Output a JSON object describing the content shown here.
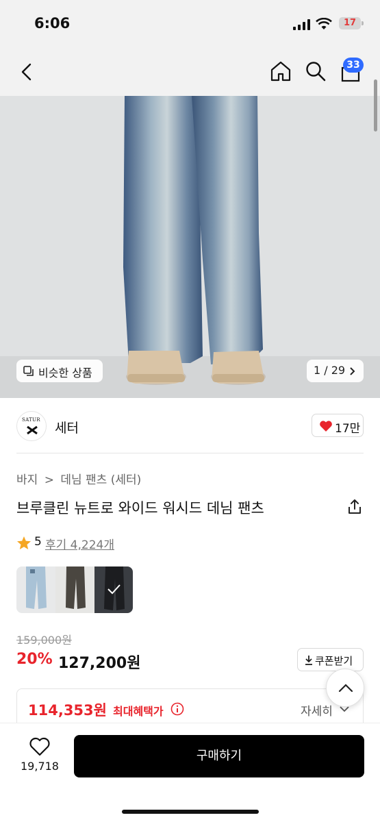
{
  "status_bar": {
    "time": "6:06",
    "battery": "17"
  },
  "nav": {
    "cart_count": "33"
  },
  "gallery": {
    "similar_label": "비슷한 상품",
    "page_indicator": "1 / 29"
  },
  "brand": {
    "logo_text": "SATUR",
    "name": "세터",
    "likes": "17만"
  },
  "breadcrumb": {
    "root": "바지",
    "sep": ">",
    "current": "데님 팬츠 (세터)"
  },
  "product": {
    "title": "브루클린 뉴트로 와이드 워시드 데님 팬츠",
    "rating": "5",
    "reviews_label": "후기 4,224개",
    "original_price": "159,000원",
    "discount": "20%",
    "price": "127,200원",
    "coupon_label": "쿠폰받기",
    "max_benefit_price": "114,353원",
    "max_benefit_label": "최대혜택가",
    "details_label": "자세히"
  },
  "bottom_bar": {
    "wishlist_count": "19,718",
    "buy_label": "구매하기"
  },
  "colors": {
    "accent_red": "#e8242c",
    "badge_blue": "#2f6bff"
  },
  "icons": [
    "back-arrow-icon",
    "home-icon",
    "search-icon",
    "cart-icon",
    "copy-icon",
    "chevron-right-icon",
    "heart-icon",
    "share-icon",
    "star-icon",
    "download-icon",
    "chevron-up-icon",
    "info-icon",
    "chevron-down-icon",
    "checkmark-icon"
  ]
}
